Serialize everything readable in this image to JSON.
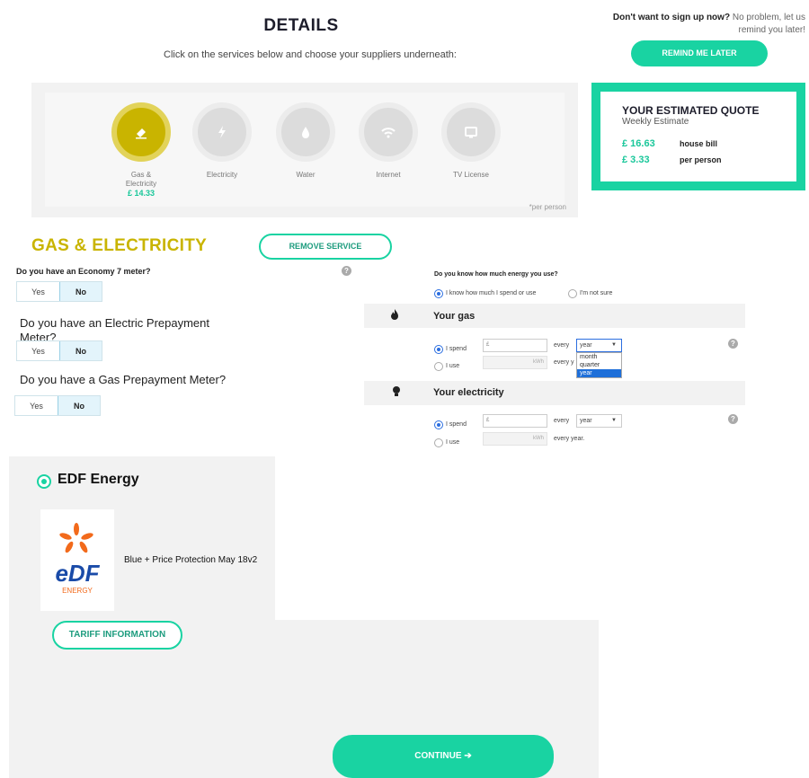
{
  "header": {
    "title": "DETAILS",
    "subtitle": "Click on the services below and choose your suppliers underneath:"
  },
  "remind": {
    "bold": "Don't want to sign up now?",
    "text": " No problem, let us remind you later!",
    "button": "REMIND ME LATER"
  },
  "services": [
    {
      "label": "Gas &",
      "label2": "Electricity",
      "price": "£ 14.33",
      "icon": "eraser-icon",
      "active": true
    },
    {
      "label": "Electricity",
      "label2": "",
      "price": "",
      "icon": "lightning-icon",
      "active": false
    },
    {
      "label": "Water",
      "label2": "",
      "price": "",
      "icon": "water-drop-icon",
      "active": false
    },
    {
      "label": "Internet",
      "label2": "",
      "price": "",
      "icon": "wifi-icon",
      "active": false
    },
    {
      "label": "TV License",
      "label2": "",
      "price": "",
      "icon": "tv-icon",
      "active": false
    }
  ],
  "per_person_note": "*per person",
  "quote": {
    "title": "YOUR ESTIMATED QUOTE",
    "subtitle": "Weekly Estimate",
    "house_value": "£ 16.63",
    "house_label": "house bill",
    "person_value": "£ 3.33",
    "person_label": "per person"
  },
  "section": {
    "title": "GAS & ELECTRICITY",
    "remove": "REMOVE SERVICE"
  },
  "questions": {
    "economy7": "Do you have an Economy 7 meter?",
    "electric_prepay": "Do you have an Electric Prepayment Meter?",
    "gas_prepay": "Do you have a Gas Prepayment Meter?",
    "yes": "Yes",
    "no": "No"
  },
  "energy": {
    "question": "Do you know how much energy you use?",
    "opt_know": "I know how much I spend or use",
    "opt_not_sure": "I'm not sure",
    "gas_title": "Your gas",
    "elec_title": "Your electricity",
    "spend": "I spend",
    "use": "I use",
    "currency": "£",
    "kwh": "kWh",
    "every": "every",
    "every_year": "every year.",
    "select_value": "year",
    "options": [
      "month",
      "quarter",
      "year"
    ]
  },
  "supplier": {
    "name": "EDF Energy",
    "tariff": "Blue + Price Protection May 18v2",
    "logo_text": "eDF",
    "logo_sub": "ENERGY",
    "tariff_button": "TARIFF INFORMATION"
  },
  "continue": "CONTINUE",
  "colors": {
    "accent": "#19d3a2",
    "active_service": "#c9b400"
  }
}
